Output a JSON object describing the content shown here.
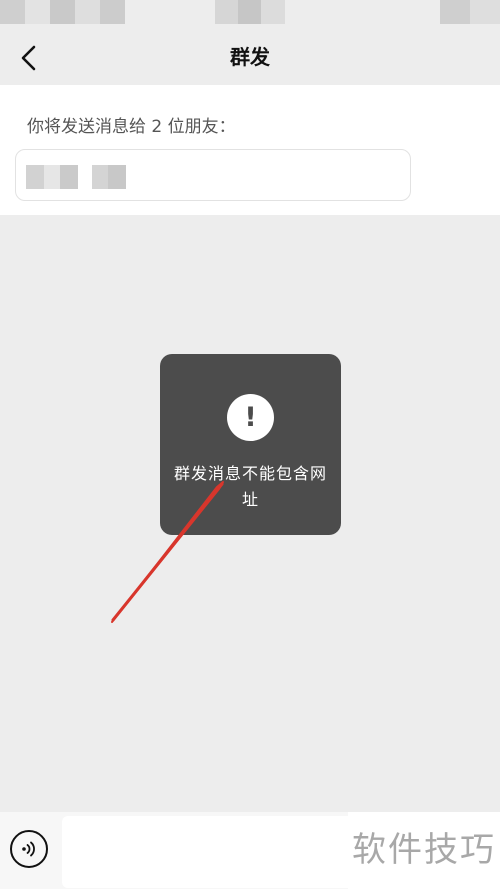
{
  "nav": {
    "title": "群发",
    "back_icon": "chevron-left-icon"
  },
  "recipients": {
    "prompt": "你将发送消息给 2 位朋友："
  },
  "toast": {
    "icon": "!",
    "message": "群发消息不能包含网址"
  },
  "composer": {
    "voice_icon": "voice-icon",
    "input_value": ""
  },
  "watermark": "软件技巧",
  "colors": {
    "background": "#ededed",
    "toast_bg": "#4c4c4c",
    "annotation_arrow": "#d8362c"
  }
}
